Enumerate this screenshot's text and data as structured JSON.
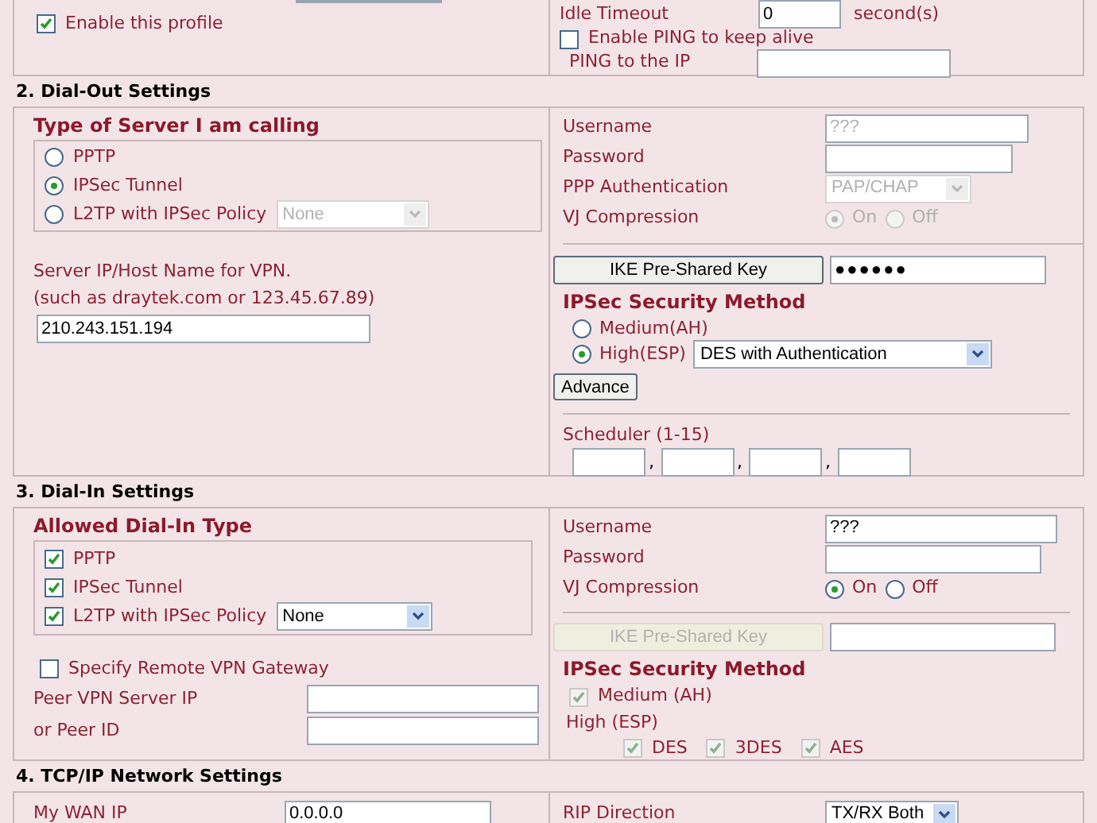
{
  "profile": {
    "enable": {
      "label": "Enable this profile",
      "checked": true
    },
    "idle_timeout": {
      "label": "Idle Timeout",
      "value": "0",
      "unit": "second(s)"
    },
    "ping_keep_alive": {
      "label": "Enable PING to keep alive",
      "checked": false
    },
    "ping_ip": {
      "label": "PING to the IP"
    }
  },
  "dial_out": {
    "title": "2. Dial-Out Settings",
    "server_type": {
      "title": "Type of Server I am calling",
      "options": [
        {
          "label": "PPTP",
          "selected": false
        },
        {
          "label": "IPSec Tunnel",
          "selected": true
        },
        {
          "label": "L2TP with IPSec Policy",
          "selected": false
        }
      ],
      "policy_select": {
        "value": "None",
        "disabled": true
      }
    },
    "server_host": {
      "label": "Server IP/Host Name for VPN.",
      "hint": "(such as draytek.com or 123.45.67.89)",
      "value": "210.243.151.194"
    },
    "username": {
      "label": "Username",
      "value": "???",
      "disabled": true
    },
    "password": {
      "label": "Password"
    },
    "ppp_auth": {
      "label": "PPP Authentication",
      "value": "PAP/CHAP",
      "disabled": true
    },
    "vj": {
      "label": "VJ Compression",
      "disabled": true,
      "options": [
        {
          "label": "On",
          "selected": true
        },
        {
          "label": "Off",
          "selected": false
        }
      ]
    },
    "ike": {
      "label": "IKE Pre-Shared Key",
      "disabled": false,
      "value": "●●●●●●"
    },
    "ipsec": {
      "title": "IPSec Security Method",
      "options": [
        {
          "label": "Medium(AH)",
          "selected": false
        },
        {
          "label": "High(ESP)",
          "selected": true
        }
      ],
      "esp_select": "DES with Authentication"
    },
    "advance": "Advance",
    "scheduler": {
      "label": "Scheduler (1-15)",
      "separators": [
        ",",
        ",",
        ","
      ]
    }
  },
  "dial_in": {
    "title": "3. Dial-In Settings",
    "allowed": {
      "title": "Allowed Dial-In Type",
      "options": [
        {
          "label": "PPTP",
          "checked": true
        },
        {
          "label": "IPSec Tunnel",
          "checked": true
        },
        {
          "label": "L2TP with IPSec Policy",
          "checked": true
        }
      ],
      "policy_select": {
        "value": "None",
        "disabled": false
      }
    },
    "remote_gateway": {
      "label": "Specify Remote VPN Gateway",
      "checked": false
    },
    "peer_ip": {
      "label": "Peer VPN Server IP"
    },
    "peer_id": {
      "label": "or Peer ID"
    },
    "username": {
      "label": "Username",
      "value": "???",
      "disabled": false
    },
    "password": {
      "label": "Password"
    },
    "vj": {
      "label": "VJ Compression",
      "disabled": false,
      "options": [
        {
          "label": "On",
          "selected": true
        },
        {
          "label": "Off",
          "selected": false
        }
      ]
    },
    "ike": {
      "label": "IKE Pre-Shared Key",
      "disabled": true
    },
    "ipsec": {
      "title": "IPSec Security Method",
      "disabled": true,
      "medium": {
        "label": "Medium (AH)",
        "checked": true
      },
      "high_label": "High (ESP)",
      "high_options": [
        {
          "label": "DES",
          "checked": true
        },
        {
          "label": "3DES",
          "checked": true
        },
        {
          "label": "AES",
          "checked": true
        }
      ]
    }
  },
  "tcpip": {
    "title": "4. TCP/IP Network Settings",
    "my_wan_ip": {
      "label": "My WAN IP",
      "value": "0.0.0.0"
    },
    "rip_direction": {
      "label": "RIP Direction",
      "value": "TX/RX Both"
    }
  }
}
